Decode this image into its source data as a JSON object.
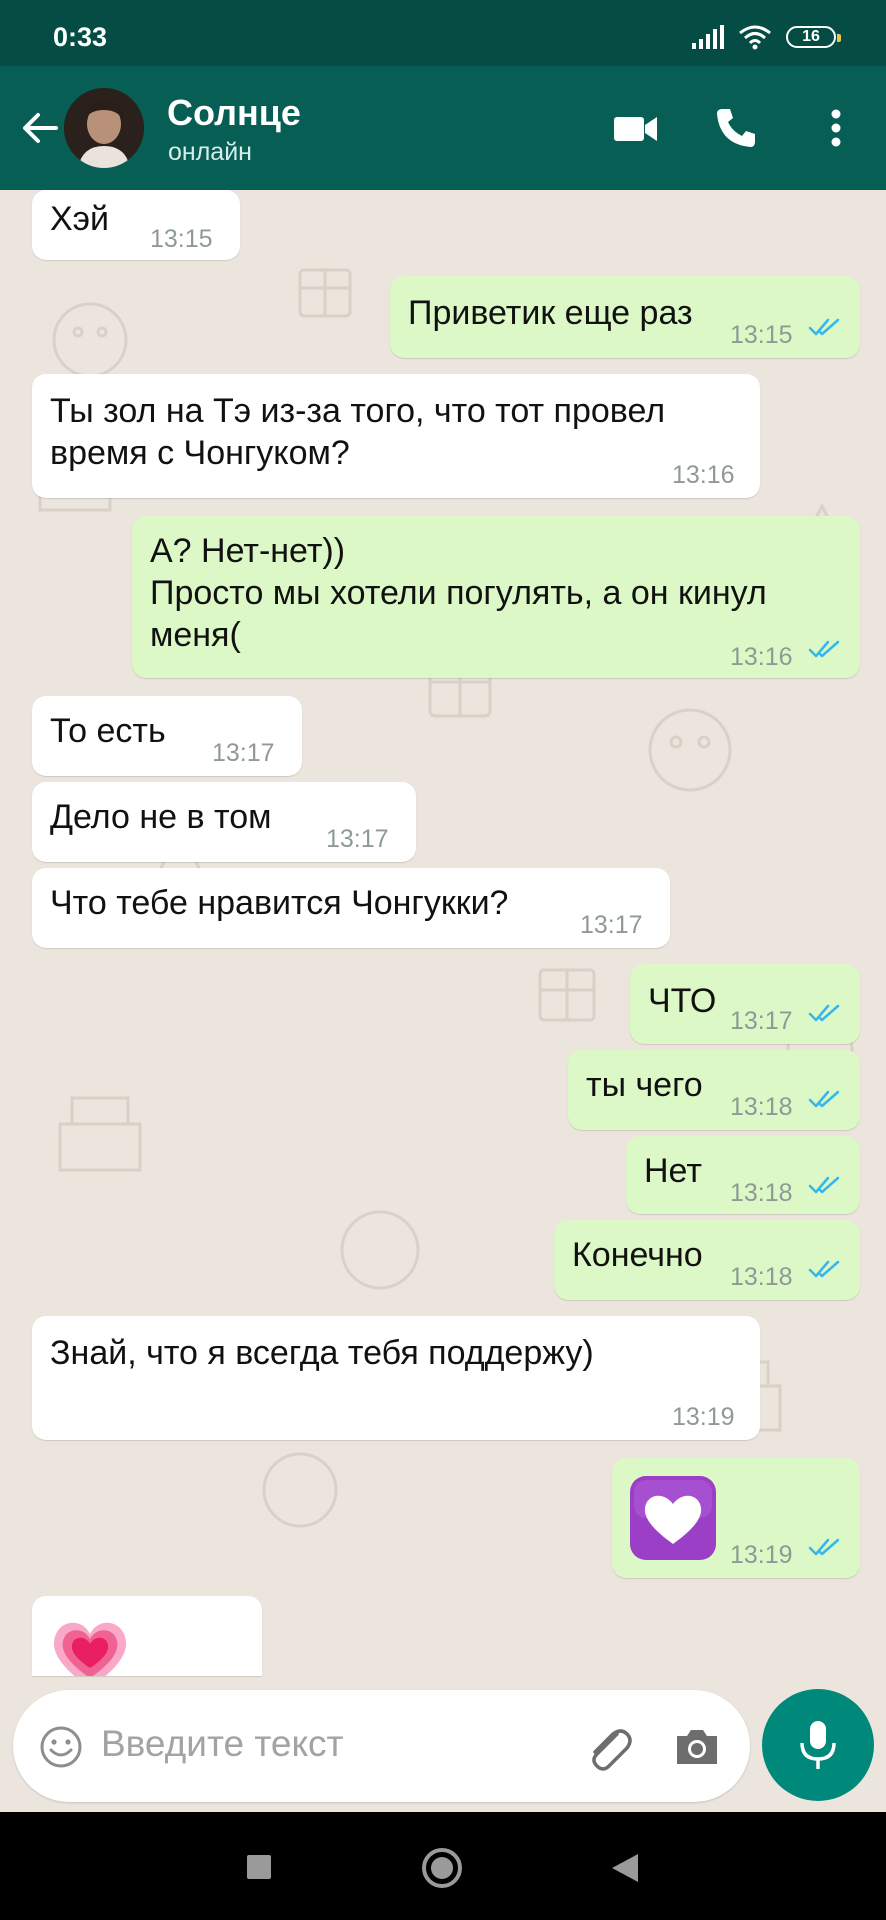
{
  "status_bar": {
    "time": "0:33",
    "battery": "16"
  },
  "header": {
    "contact_name": "Солнце",
    "contact_status": "онлайн"
  },
  "messages": [
    {
      "dir": "in",
      "text": "Хэй",
      "time": "13:15"
    },
    {
      "dir": "out",
      "text": "Приветик еще раз",
      "time": "13:15",
      "read": true
    },
    {
      "dir": "in",
      "text": "Ты зол на Тэ из-за того, что тот провел\nвремя с Чонгуком?",
      "time": "13:16"
    },
    {
      "dir": "out",
      "text": "А? Нет-нет))\nПросто мы хотели погулять, а он кинул\nменя(",
      "time": "13:16",
      "read": true
    },
    {
      "dir": "in",
      "text": "То есть",
      "time": "13:17"
    },
    {
      "dir": "in",
      "text": "Дело не в том",
      "time": "13:17"
    },
    {
      "dir": "in",
      "text": "Что тебе нравится Чонгукки?",
      "time": "13:17"
    },
    {
      "dir": "out",
      "text": "ЧТО",
      "time": "13:17",
      "read": true
    },
    {
      "dir": "out",
      "text": "ты чего",
      "time": "13:18",
      "read": true
    },
    {
      "dir": "out",
      "text": "Нет",
      "time": "13:18",
      "read": true
    },
    {
      "dir": "out",
      "text": "Конечно",
      "time": "13:18",
      "read": true
    },
    {
      "dir": "in",
      "text": "Знай, что я всегда тебя поддержу)",
      "time": "13:19"
    },
    {
      "dir": "out",
      "emoji": "white-heart-emoji",
      "time": "13:19",
      "read": true
    },
    {
      "dir": "in",
      "emoji": "growing-heart-emoji"
    }
  ],
  "composer": {
    "placeholder": "Введите текст"
  },
  "colors": {
    "status_bar": "#054D44",
    "header": "#075E54",
    "outgoing_bubble": "#DCF8C6",
    "incoming_bubble": "#FFFFFF",
    "read_ticks": "#34B7F1",
    "mic_button": "#00897B",
    "wallpaper": "#ECE5DD"
  }
}
